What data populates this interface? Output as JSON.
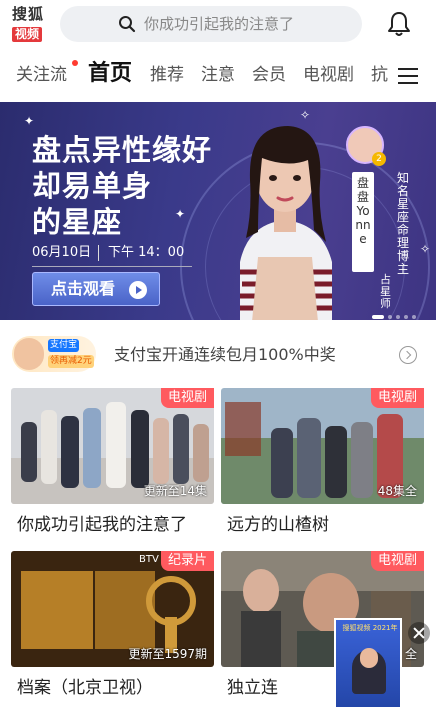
{
  "app": {
    "logo_line1": "搜狐",
    "logo_line2": "视频",
    "brand_color": "#e4393c"
  },
  "search": {
    "placeholder": "你成功引起我的注意了"
  },
  "header": {
    "bell_icon": "bell-icon",
    "search_icon": "search-icon"
  },
  "tabs": [
    {
      "label": "关注流",
      "has_dot": true
    },
    {
      "label": "首页",
      "active": true
    },
    {
      "label": "推荐"
    },
    {
      "label": "注意"
    },
    {
      "label": "会员"
    },
    {
      "label": "电视剧"
    },
    {
      "label": "抗"
    }
  ],
  "banner": {
    "title_line1": "盘点异性缘好",
    "title_line2": "却易单身",
    "title_line3": "的星座",
    "date": "06月10日",
    "time": "下午 14：00",
    "watch_label": "点击观看",
    "host_name": "盘盘 Yonne",
    "host_role": "占星师",
    "host_title": "知名星座命理博主",
    "avatar_badge": "2",
    "colors": {
      "bg": "#35358a",
      "button": "#5a75d8"
    }
  },
  "promo": {
    "alipay_label": "支付宝",
    "gift_label": "领再减2元",
    "text": "支付宝开通连续包月100%中奖"
  },
  "cards": [
    {
      "tag": "电视剧",
      "status": "更新至14集",
      "title": "你成功引起我的注意了"
    },
    {
      "tag": "电视剧",
      "status": "48集全",
      "title": "远方的山楂树"
    },
    {
      "tag": "纪录片",
      "status": "更新至1597期",
      "title": "档案（北京卫视）",
      "channel": "BTV"
    },
    {
      "tag": "电视剧",
      "status": "全",
      "title": "独立连"
    }
  ],
  "float_ad": {
    "caption": "搜狐视频 2021年"
  }
}
